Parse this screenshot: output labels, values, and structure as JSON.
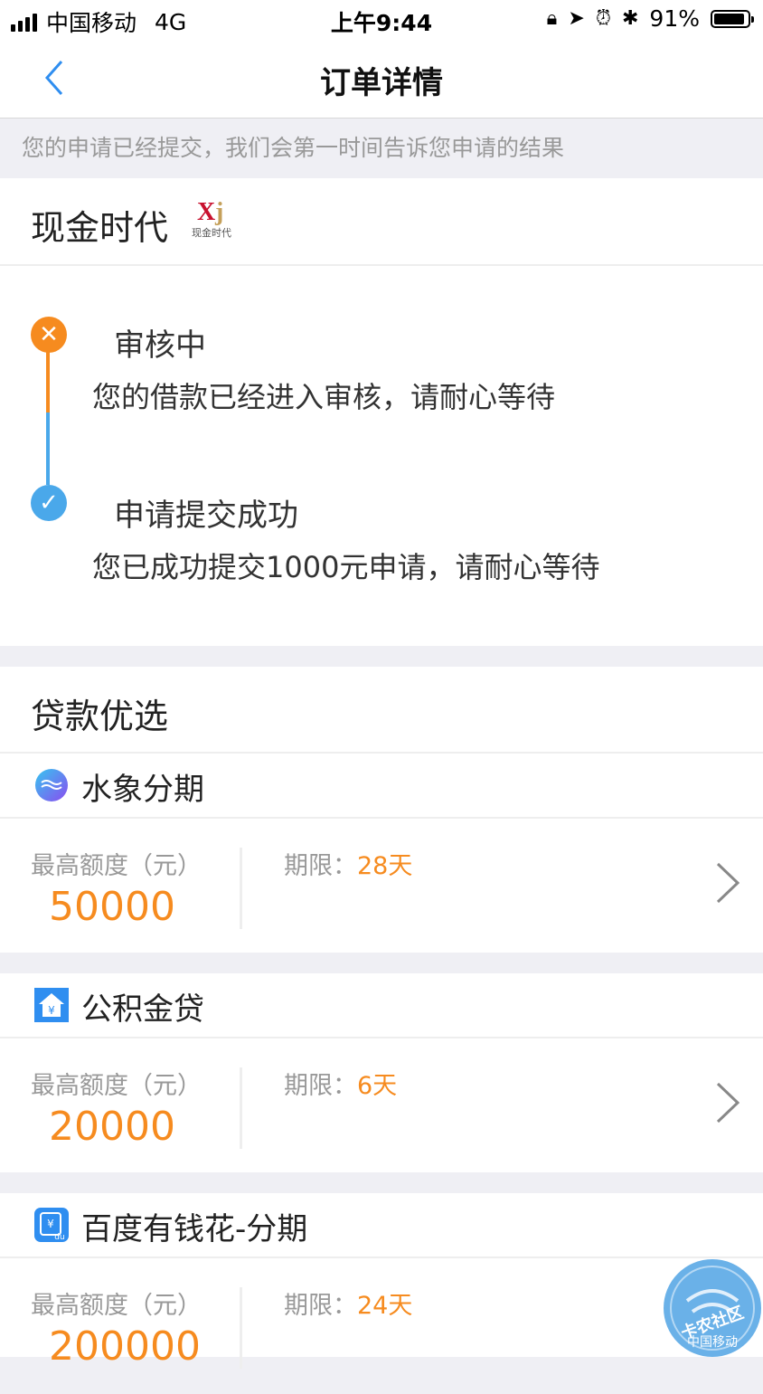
{
  "status_bar": {
    "carrier": "中国移动",
    "network": "4G",
    "time": "上午9:44",
    "battery": "91%",
    "battery_level": 0.91,
    "icons": [
      "rotation-lock-icon",
      "location-icon",
      "alarm-icon",
      "bluetooth-icon"
    ]
  },
  "nav": {
    "title": "订单详情",
    "back_icon": "chevron-left-icon"
  },
  "notice": "您的申请已经提交，我们会第一时间告诉您申请的结果",
  "merchant": {
    "name": "现金时代",
    "logo_letters": "Xj",
    "logo_caption": "现金时代"
  },
  "timeline": [
    {
      "title": "审核中",
      "desc": "您的借款已经进入审核，请耐心等待",
      "status": "in-progress",
      "icon": "close-icon",
      "color": "#f68b1f"
    },
    {
      "title": "申请提交成功",
      "desc": "您已成功提交1000元申请，请耐心等待",
      "status": "done",
      "icon": "check-icon",
      "color": "#4aa8ea"
    }
  ],
  "recommend": {
    "title": "贷款优选",
    "items": [
      {
        "name": "水象分期",
        "label": "最高额度（元）",
        "amount": "50000",
        "term_label": "期限：",
        "term_value": "28天",
        "icon": "water-wave-icon"
      },
      {
        "name": "公积金贷",
        "label": "最高额度（元）",
        "amount": "20000",
        "term_label": "期限：",
        "term_value": "6天",
        "icon": "house-yen-icon"
      },
      {
        "name": "百度有钱花-分期",
        "label": "最高额度（元）",
        "amount": "200000",
        "term_label": "期限：",
        "term_value": "24天",
        "icon": "baidu-du-icon"
      }
    ]
  },
  "watermark": {
    "text": "卡农社区",
    "sub": "中国移动"
  },
  "colors": {
    "accent": "#f68b1f",
    "blue": "#4aa8ea",
    "background": "#efeff4"
  }
}
